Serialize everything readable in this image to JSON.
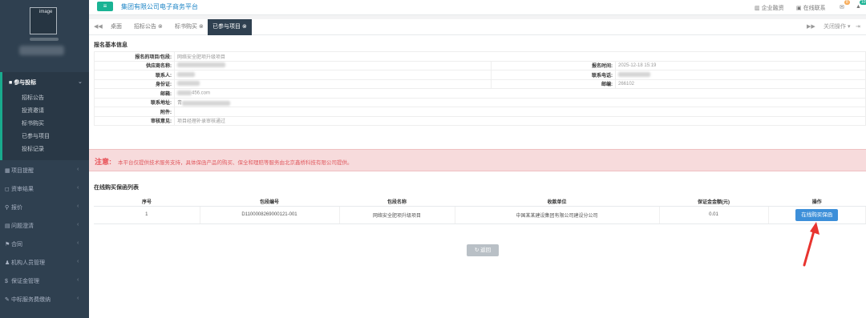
{
  "sidebar": {
    "logo_text": "image",
    "menu_open": {
      "label": "参与投标",
      "caret": "⌄"
    },
    "sub_items": [
      "招标公告",
      "投资邀请",
      "标书购买",
      "已参与项目",
      "投标记录"
    ],
    "items": [
      {
        "icon": "▦",
        "label": "项目提醒"
      },
      {
        "icon": "◻",
        "label": "资审结果"
      },
      {
        "icon": "⚲",
        "label": "报价"
      },
      {
        "icon": "▤",
        "label": "问题澄清"
      },
      {
        "icon": "⚑",
        "label": "合同"
      },
      {
        "icon": "♟",
        "label": "机构人员管理"
      },
      {
        "icon": "$",
        "label": "保证金管理"
      },
      {
        "icon": "✎",
        "label": "中标服务费缴纳"
      }
    ],
    "chevron": "‹"
  },
  "topbar": {
    "menu_icon": "≡",
    "title": "集团有限公司电子商务平台",
    "links": [
      "企业融资",
      "在线联系"
    ],
    "badge1": "8",
    "badge2": "10"
  },
  "tabs": {
    "prev": "◀◀",
    "items": [
      {
        "label": "桌面",
        "closable": false
      },
      {
        "label": "招标公告",
        "closable": true
      },
      {
        "label": "标书购买",
        "closable": true
      },
      {
        "label": "已参与项目",
        "closable": true
      }
    ],
    "close_glyph": "⊗",
    "next": "▶▶",
    "ops": "关闭操作 ▾",
    "exit": "⇥ 退"
  },
  "info": {
    "title": "报名基本信息",
    "rows": [
      {
        "label": "报名的项目/包段:",
        "value": "网络安全肥项升级项目"
      },
      {
        "label": "供应商名称:",
        "value": "",
        "label2": "报名时间:",
        "value2": "2025-12-18 15:19"
      },
      {
        "label": "联系人:",
        "value": "",
        "label2": "联系电话:",
        "value2": ""
      },
      {
        "label": "身份证:",
        "value": "",
        "label2": "邮编:",
        "value2": "266102"
      },
      {
        "label": "邮箱:",
        "value": "456.com"
      },
      {
        "label": "联系地址:",
        "value": "青"
      },
      {
        "label": "附件:",
        "value": ""
      },
      {
        "label": "审核意见:",
        "value": "项目经理补录审核通过"
      }
    ]
  },
  "notice": {
    "label": "注意:",
    "text": "本平台仅提供技术服务支持，具体保函产品的购买、保全和理赔等服务由北京鑫桥科技有限公司提供。"
  },
  "guarantee": {
    "title": "在线购买保函列表",
    "columns": [
      "序号",
      "包段编号",
      "包段名称",
      "收款单位",
      "保证金金额(元)",
      "操作"
    ],
    "rows": [
      {
        "no": "1",
        "code": "D1100008269000121-001",
        "name": "网络安全肥项升级项目",
        "payee": "中国某某建设集团有限公司建设分公司",
        "amount": "0.01",
        "action": "在线购买保函"
      }
    ],
    "back": "返回",
    "back_icon": "↻"
  },
  "colors": {
    "sidebar": "#2f4050",
    "accent": "#1ab394",
    "link": "#1c84c6",
    "button": "#3d8fd9",
    "notice_bg": "#f7dbdc",
    "arrow": "#e8342f"
  }
}
